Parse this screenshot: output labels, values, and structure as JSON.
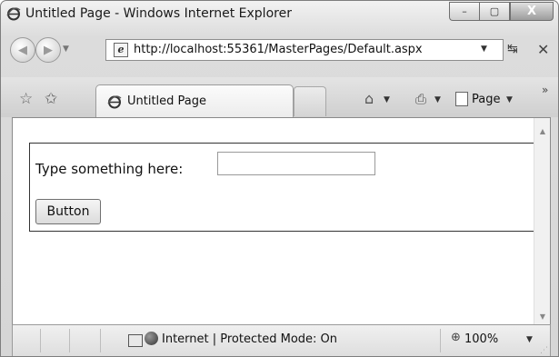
{
  "window": {
    "title": "Untitled Page - Windows Internet Explorer",
    "controls": {
      "minimize": "–",
      "maximize": "▢",
      "close": "X"
    }
  },
  "navigation": {
    "address": "http://localhost:55361/MasterPages/Default.aspx",
    "back_icon": "back-arrow-icon",
    "forward_icon": "forward-arrow-icon",
    "refresh_glyph": "↹",
    "stop_glyph": "✕"
  },
  "tabs": [
    {
      "label": "Untitled Page",
      "active": true
    }
  ],
  "command_bar": {
    "page_menu_label": "Page",
    "icons": [
      "favorites-star-icon",
      "add-favorites-icon",
      "home-icon",
      "print-icon",
      "page-icon"
    ],
    "more_glyph": "»"
  },
  "page": {
    "prompt_label": "Type something here:",
    "input_value": "",
    "button_label": "Button"
  },
  "status_bar": {
    "status_text": "Internet | Protected Mode: On",
    "zoom": "100%"
  },
  "colors": {
    "chrome_gray": "#d6d6d6",
    "content_bg": "#ffffff",
    "panel_border": "#333333"
  }
}
